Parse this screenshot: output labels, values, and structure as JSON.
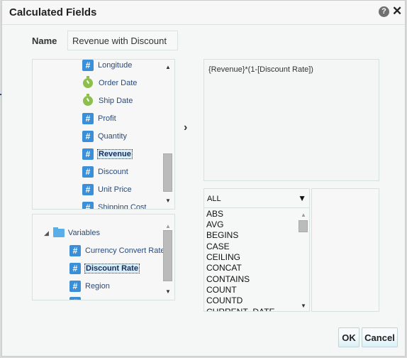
{
  "dialog": {
    "title": "Calculated Fields",
    "help_icon": "?",
    "close_icon": "✕"
  },
  "name_field": {
    "label": "Name",
    "value": "Revenue with Discount"
  },
  "fields": [
    {
      "label": "Longitude",
      "icon": "number-icon"
    },
    {
      "label": "Order Date",
      "icon": "date-icon"
    },
    {
      "label": "Ship Date",
      "icon": "date-icon"
    },
    {
      "label": "Profit",
      "icon": "number-icon"
    },
    {
      "label": "Quantity",
      "icon": "number-icon"
    },
    {
      "label": "Revenue",
      "icon": "number-icon",
      "selected": true
    },
    {
      "label": "Discount",
      "icon": "number-icon"
    },
    {
      "label": "Unit Price",
      "icon": "number-icon"
    },
    {
      "label": "Shipping Cost",
      "icon": "number-icon"
    }
  ],
  "variables": {
    "folder_label": "Variables",
    "items": [
      {
        "label": "Currency Convert Rate",
        "icon": "number-icon"
      },
      {
        "label": "Discount Rate",
        "icon": "number-icon",
        "selected": true
      },
      {
        "label": "Region",
        "icon": "number-icon"
      }
    ]
  },
  "insert_arrow": "›",
  "formula": "{Revenue}*(1-[Discount Rate])",
  "functions": {
    "category": "ALL",
    "items": [
      "ABS",
      "AVG",
      "BEGINS",
      "CASE",
      "CEILING",
      "CONCAT",
      "CONTAINS",
      "COUNT",
      "COUNTD",
      "CURRENT_DATE"
    ]
  },
  "buttons": {
    "ok": "OK",
    "cancel": "Cancel"
  }
}
